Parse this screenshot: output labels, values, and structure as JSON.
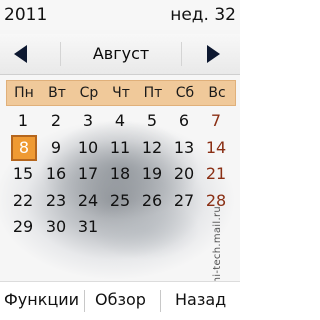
{
  "status_bar": {
    "year": "2011",
    "week": "нед. 32"
  },
  "month_nav": {
    "month": "Август",
    "prev_icon": "arrow-left-icon",
    "next_icon": "arrow-right-icon"
  },
  "weekdays": [
    "Пн",
    "Вт",
    "Ср",
    "Чт",
    "Пт",
    "Сб",
    "Вс"
  ],
  "days": [
    [
      "1",
      "2",
      "3",
      "4",
      "5",
      "6",
      "7"
    ],
    [
      "8",
      "9",
      "10",
      "11",
      "12",
      "13",
      "14"
    ],
    [
      "15",
      "16",
      "17",
      "18",
      "19",
      "20",
      "21"
    ],
    [
      "22",
      "23",
      "24",
      "25",
      "26",
      "27",
      "28"
    ],
    [
      "29",
      "30",
      "31",
      "",
      "",
      "",
      ""
    ]
  ],
  "today": "8",
  "softkeys": {
    "left": "Функции",
    "middle": "Обзор",
    "right": "Назад"
  },
  "watermark": "© hi-tech.mail.ru",
  "colors": {
    "weekday_bg": "#f0c99a",
    "today_bg": "#ef9a33",
    "weekend_text": "#8a2f14"
  }
}
